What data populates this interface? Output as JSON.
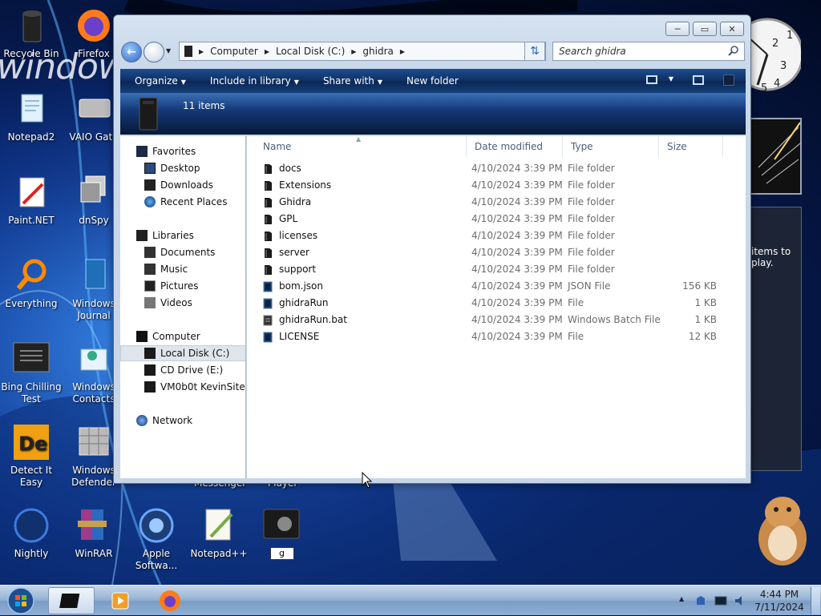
{
  "desktop": {
    "wordmark": "windows",
    "icons": [
      {
        "label": "Recycle Bin",
        "icon": "recycle-bin-icon"
      },
      {
        "label": "Firefox",
        "icon": "firefox-icon"
      },
      {
        "label": "Notepad2",
        "icon": "notepad2-icon"
      },
      {
        "label": "VAIO Gate",
        "icon": "vaio-gate-icon"
      },
      {
        "label": "Paint.NET",
        "icon": "paint-net-icon"
      },
      {
        "label": "dnSpy",
        "icon": "dnspy-icon"
      },
      {
        "label": "Everything",
        "icon": "everything-search-icon"
      },
      {
        "label": "Windows Journal",
        "icon": "windows-journal-icon"
      },
      {
        "label": "Bing Chilling Test",
        "icon": "bing-chilling-test-icon"
      },
      {
        "label": "Windows Contacts",
        "icon": "windows-contacts-icon"
      },
      {
        "label": "Detect It Easy",
        "icon": "detect-it-easy-icon"
      },
      {
        "label": "Windows Defender",
        "icon": "windows-defender-icon"
      },
      {
        "label": "Nightly",
        "icon": "firefox-nightly-icon"
      },
      {
        "label": "WinRAR",
        "icon": "winrar-icon"
      },
      {
        "label": "Apple Softwa...",
        "icon": "apple-software-update-icon"
      },
      {
        "label": "Notepad++",
        "icon": "notepad-plus-plus-icon"
      }
    ],
    "partial_labels": {
      "messenger": "Messenger",
      "player": "Player"
    },
    "rename_value": "g",
    "gadget_text": "items to play."
  },
  "window": {
    "controls": {
      "minimize": "─",
      "maximize": "▭",
      "close": "✕"
    },
    "breadcrumb": [
      "Computer",
      "Local Disk (C:)",
      "ghidra"
    ],
    "search_placeholder": "Search ghidra",
    "toolbar": {
      "organize": "Organize",
      "include_in_library": "Include in library",
      "share_with": "Share with",
      "new_folder": "New folder"
    },
    "details": {
      "count": "11 items"
    },
    "nav": {
      "favorites": "Favorites",
      "desktop": "Desktop",
      "downloads": "Downloads",
      "recent_places": "Recent Places",
      "libraries": "Libraries",
      "documents": "Documents",
      "music": "Music",
      "pictures": "Pictures",
      "videos": "Videos",
      "computer": "Computer",
      "local_disk": "Local Disk (C:)",
      "cd_drive": "CD Drive (E:)",
      "network_drive": "VM0b0t KevinSite",
      "network": "Network"
    },
    "columns": {
      "name": "Name",
      "date": "Date modified",
      "type": "Type",
      "size": "Size"
    },
    "files": [
      {
        "name": "docs",
        "date": "4/10/2024 3:39 PM",
        "type": "File folder",
        "size": "",
        "icon": "folder-icon"
      },
      {
        "name": "Extensions",
        "date": "4/10/2024 3:39 PM",
        "type": "File folder",
        "size": "",
        "icon": "folder-icon"
      },
      {
        "name": "Ghidra",
        "date": "4/10/2024 3:39 PM",
        "type": "File folder",
        "size": "",
        "icon": "folder-icon"
      },
      {
        "name": "GPL",
        "date": "4/10/2024 3:39 PM",
        "type": "File folder",
        "size": "",
        "icon": "folder-icon"
      },
      {
        "name": "licenses",
        "date": "4/10/2024 3:39 PM",
        "type": "File folder",
        "size": "",
        "icon": "folder-icon"
      },
      {
        "name": "server",
        "date": "4/10/2024 3:39 PM",
        "type": "File folder",
        "size": "",
        "icon": "folder-icon"
      },
      {
        "name": "support",
        "date": "4/10/2024 3:39 PM",
        "type": "File folder",
        "size": "",
        "icon": "folder-icon"
      },
      {
        "name": "bom.json",
        "date": "4/10/2024 3:39 PM",
        "type": "JSON File",
        "size": "156 KB",
        "icon": "file-icon"
      },
      {
        "name": "ghidraRun",
        "date": "4/10/2024 3:39 PM",
        "type": "File",
        "size": "1 KB",
        "icon": "file-icon"
      },
      {
        "name": "ghidraRun.bat",
        "date": "4/10/2024 3:39 PM",
        "type": "Windows Batch File",
        "size": "1 KB",
        "icon": "batch-file-icon"
      },
      {
        "name": "LICENSE",
        "date": "4/10/2024 3:39 PM",
        "type": "File",
        "size": "12 KB",
        "icon": "file-icon"
      }
    ]
  },
  "taskbar": {
    "time": "4:44 PM",
    "date": "7/11/2024"
  }
}
